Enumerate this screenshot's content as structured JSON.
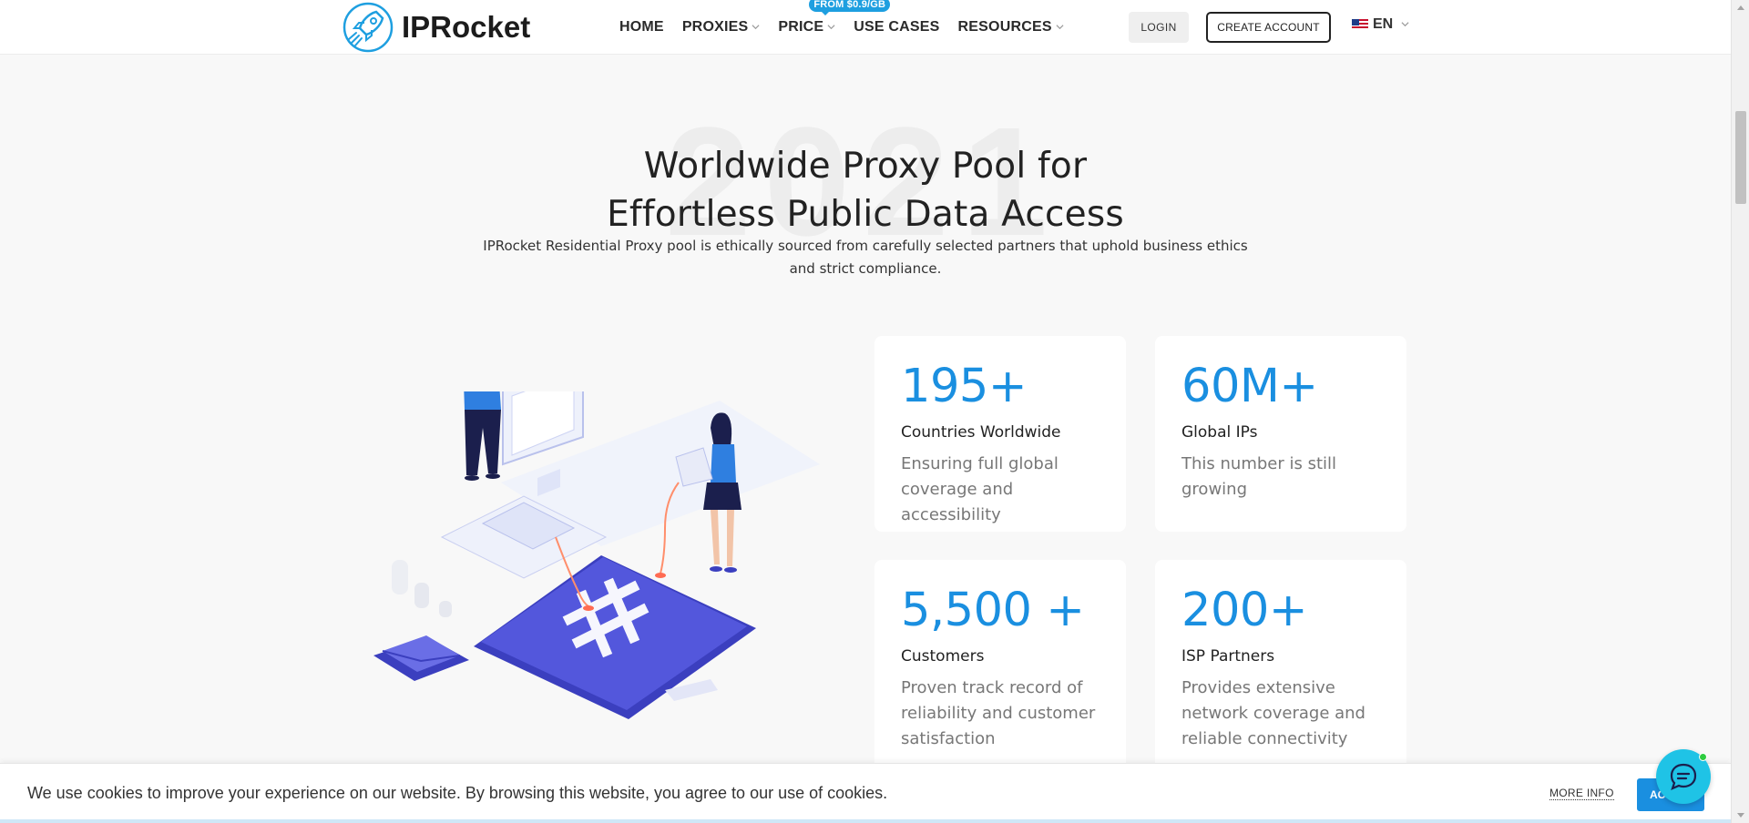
{
  "header": {
    "logo_text": "IPRocket",
    "nav": [
      {
        "label": "HOME",
        "has_dropdown": false
      },
      {
        "label": "PROXIES",
        "has_dropdown": true
      },
      {
        "label": "PRICE",
        "has_dropdown": true,
        "badge": "FROM $0.9/GB"
      },
      {
        "label": "USE CASES",
        "has_dropdown": false
      },
      {
        "label": "RESOURCES",
        "has_dropdown": true
      }
    ],
    "login_label": "LOGIN",
    "create_account_label": "CREATE ACCOUNT",
    "language_label": "EN",
    "language_flag_icon": "us-flag-icon"
  },
  "hero": {
    "watermark": "2021",
    "title_line1": "Worldwide Proxy Pool for",
    "title_line2": "Effortless Public Data Access",
    "subtitle_line1": "IPRocket Residential Proxy pool is ethically sourced from carefully selected partners that uphold business ethics",
    "subtitle_line2": "and strict compliance."
  },
  "stats": [
    {
      "value": "195+",
      "label": "Countries Worldwide",
      "description": "Ensuring full global coverage and accessibility"
    },
    {
      "value": "60M+",
      "label": "Global IPs",
      "description": "This number is still growing"
    },
    {
      "value": "5,500 +",
      "label": "Customers",
      "description": "Proven track record of reliability and customer satisfaction"
    },
    {
      "value": "200+",
      "label": "ISP Partners",
      "description": "Provides extensive network coverage and reliable connectivity"
    }
  ],
  "cookie_bar": {
    "text": "We use cookies to improve your experience on our website. By browsing this website, you agree to our use of cookies.",
    "more_info_label": "MORE INFO",
    "accept_label": "ACCEPT"
  },
  "colors": {
    "accent": "#1a8fe0",
    "badge": "#1e9fe0",
    "chat": "#1fc3e6",
    "illustration_primary": "#4b4fd6"
  }
}
